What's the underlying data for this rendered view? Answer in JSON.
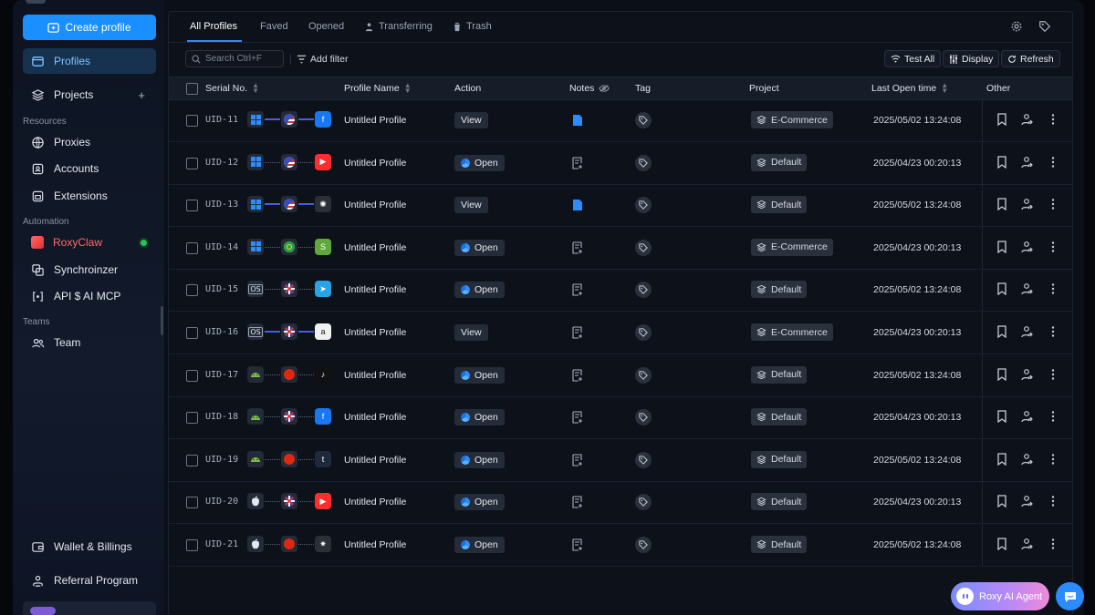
{
  "sidebar": {
    "create_label": "Create profile",
    "profiles_label": "Profiles",
    "projects_label": "Projects",
    "resources_label": "Resources",
    "proxies_label": "Proxies",
    "accounts_label": "Accounts",
    "extensions_label": "Extensions",
    "automation_label": "Automation",
    "roxyclaw_label": "RoxyClaw",
    "synchronizer_label": "Synchroinzer",
    "api_label": "API $ AI MCP",
    "teams_label": "Teams",
    "team_label": "Team",
    "wallet_label": "Wallet & Billings",
    "referral_label": "Referral Program"
  },
  "tabs": [
    {
      "label": "All Profiles"
    },
    {
      "label": "Faved"
    },
    {
      "label": "Opened"
    },
    {
      "label": "Transferring"
    },
    {
      "label": "Trash"
    }
  ],
  "toolbar": {
    "search_placeholder": "Search  Ctrl+F",
    "add_filter": "Add filter",
    "test_all": "Test All",
    "display": "Display",
    "refresh": "Refresh"
  },
  "columns": {
    "serial": "Serial No.",
    "profile_name": "Profile Name",
    "action": "Action",
    "notes": "Notes",
    "tag": "Tag",
    "project": "Project",
    "last_open": "Last Open time",
    "other": "Other"
  },
  "rows": [
    {
      "uid": "UID-11",
      "os": "windows",
      "flag": "us",
      "site": "facebook",
      "proxy": true,
      "name": "Untitled Profile",
      "action": "View",
      "note": "filled",
      "project": "E-Commerce",
      "time": "2025/05/02 13:24:08"
    },
    {
      "uid": "UID-12",
      "os": "windows",
      "flag": "us",
      "site": "youtube",
      "proxy": false,
      "name": "Untitled Profile",
      "action": "Open",
      "note": "empty",
      "project": "Default",
      "time": "2025/04/23 00:20:13"
    },
    {
      "uid": "UID-13",
      "os": "windows",
      "flag": "us",
      "site": "openai",
      "proxy": true,
      "name": "Untitled Profile",
      "action": "View",
      "note": "filled",
      "project": "Default",
      "time": "2025/05/02 13:24:08"
    },
    {
      "uid": "UID-14",
      "os": "windows",
      "flag": "br",
      "site": "shopify",
      "proxy": false,
      "name": "Untitled Profile",
      "action": "Open",
      "note": "empty",
      "project": "E-Commerce",
      "time": "2025/04/23 00:20:13"
    },
    {
      "uid": "UID-15",
      "os": "macos",
      "flag": "uk",
      "site": "telegram",
      "proxy": false,
      "name": "Untitled Profile",
      "action": "Open",
      "note": "empty",
      "project": "Default",
      "time": "2025/05/02 13:24:08"
    },
    {
      "uid": "UID-16",
      "os": "macos",
      "flag": "uk",
      "site": "amazon",
      "proxy": true,
      "name": "Untitled Profile",
      "action": "View",
      "note": "empty",
      "project": "E-Commerce",
      "time": "2025/04/23 00:20:13"
    },
    {
      "uid": "UID-17",
      "os": "android",
      "flag": "hk",
      "site": "tiktok",
      "proxy": false,
      "name": "Untitled Profile",
      "action": "Open",
      "note": "empty",
      "project": "Default",
      "time": "2025/05/02 13:24:08"
    },
    {
      "uid": "UID-18",
      "os": "android",
      "flag": "uk",
      "site": "facebook",
      "proxy": false,
      "name": "Untitled Profile",
      "action": "Open",
      "note": "empty",
      "project": "Default",
      "time": "2025/04/23 00:20:13"
    },
    {
      "uid": "UID-19",
      "os": "android",
      "flag": "hk",
      "site": "tumblr",
      "proxy": false,
      "name": "Untitled Profile",
      "action": "Open",
      "note": "empty",
      "project": "Default",
      "time": "2025/05/02 13:24:08"
    },
    {
      "uid": "UID-20",
      "os": "apple",
      "flag": "uk",
      "site": "youtube",
      "proxy": false,
      "name": "Untitled Profile",
      "action": "Open",
      "note": "empty",
      "project": "Default",
      "time": "2025/04/23 00:20:13"
    },
    {
      "uid": "UID-21",
      "os": "apple",
      "flag": "hk",
      "site": "claude",
      "proxy": false,
      "name": "Untitled Profile",
      "action": "Open",
      "note": "empty",
      "project": "Default",
      "time": "2025/05/02 13:24:08"
    }
  ],
  "site_glyphs": {
    "facebook": "f",
    "youtube": "▶",
    "openai": "✺",
    "shopify": "S",
    "telegram": "➤",
    "amazon": "a",
    "tiktok": "♪",
    "tumblr": "t",
    "claude": "✷"
  },
  "site_colors": {
    "facebook": "#1877f2",
    "youtube": "#ff2d2d",
    "openai": "#2b2f36",
    "shopify": "#5fa83c",
    "telegram": "#2aa3e6",
    "amazon": "#f1f1f1",
    "tiktok": "#111111",
    "tumblr": "#1d2a3c",
    "claude": "#2b2f36"
  },
  "agent": {
    "label": "Roxy AI Agent"
  },
  "colors": {
    "accent": "#1a8fff",
    "sidebar_active": "#17324f",
    "online": "#25c25a"
  }
}
